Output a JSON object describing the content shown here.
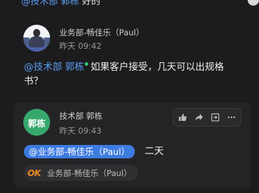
{
  "previous_message": {
    "mention": "@技术部 郭栋",
    "tail": " 好的"
  },
  "message1": {
    "sender": "业务部-畅佳乐（Paul）",
    "time": "昨天 09:42",
    "mention": "@技术部 郭栋",
    "text": "如果客户接受，几天可以出规格书？"
  },
  "message2": {
    "sender": "技术部 郭栋",
    "avatar_text": "郭栋",
    "time": "昨天 09:43",
    "mention": "@业务部-畅佳乐（Paul）",
    "text": "二天",
    "reaction": {
      "icon": "ok-icon",
      "icon_text": "OK",
      "user": "业务部-畅佳乐（Paul）"
    },
    "toolbar": [
      "thumbs-up-icon",
      "forward-icon",
      "quote-reply-icon",
      "more-icon"
    ]
  },
  "colors": {
    "background": "#1c1c1e",
    "mention_link": "#5a9bf0",
    "mention_pill": "#3d7be0",
    "avatar2": "#37a86c",
    "online": "#2ecc71",
    "ok": "#f08a24"
  }
}
